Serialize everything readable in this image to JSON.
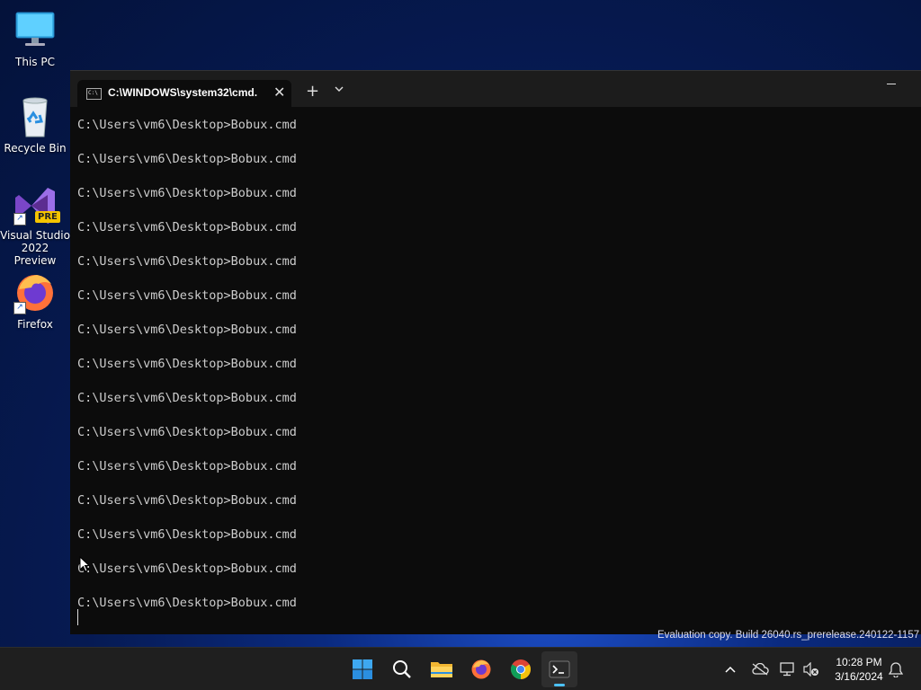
{
  "desktop": {
    "icons": [
      {
        "label": "This PC",
        "icon": "monitor-icon"
      },
      {
        "label": "Recycle Bin",
        "icon": "recycle-bin-icon"
      },
      {
        "label_line1": "Visual Studio",
        "label_line2": "2022 Preview",
        "badge": "PRE",
        "icon": "visual-studio-icon"
      },
      {
        "label": "Firefox",
        "icon": "firefox-icon"
      }
    ],
    "watermark": "Evaluation copy. Build 26040.rs_prerelease.240122-1157"
  },
  "terminal": {
    "tab_title": "C:\\WINDOWS\\system32\\cmd.",
    "tab_icon_text": "C:\\",
    "close_glyph": "✕",
    "new_tab_glyph": "+",
    "dropdown_glyph": "⌄",
    "lines": [
      "C:\\Users\\vm6\\Desktop>Bobux.cmd",
      "C:\\Users\\vm6\\Desktop>Bobux.cmd",
      "C:\\Users\\vm6\\Desktop>Bobux.cmd",
      "C:\\Users\\vm6\\Desktop>Bobux.cmd",
      "C:\\Users\\vm6\\Desktop>Bobux.cmd",
      "C:\\Users\\vm6\\Desktop>Bobux.cmd",
      "C:\\Users\\vm6\\Desktop>Bobux.cmd",
      "C:\\Users\\vm6\\Desktop>Bobux.cmd",
      "C:\\Users\\vm6\\Desktop>Bobux.cmd",
      "C:\\Users\\vm6\\Desktop>Bobux.cmd",
      "C:\\Users\\vm6\\Desktop>Bobux.cmd",
      "C:\\Users\\vm6\\Desktop>Bobux.cmd",
      "C:\\Users\\vm6\\Desktop>Bobux.cmd",
      "C:\\Users\\vm6\\Desktop>Bobux.cmd",
      "C:\\Users\\vm6\\Desktop>Bobux.cmd"
    ]
  },
  "taskbar": {
    "apps": [
      "start-icon",
      "search-icon",
      "file-explorer-icon",
      "firefox-icon",
      "chrome-icon",
      "terminal-icon"
    ],
    "active_app": "terminal-icon",
    "tray_chevron": "^",
    "time": "10:28 PM",
    "date": "3/16/2024"
  },
  "colors": {
    "terminal_bg": "#0c0c0c",
    "titlebar_bg": "#1c1c1c",
    "console_text": "#cccccc",
    "taskbar_bg": "#1f1f1f",
    "accent": "#4cc2ff"
  }
}
